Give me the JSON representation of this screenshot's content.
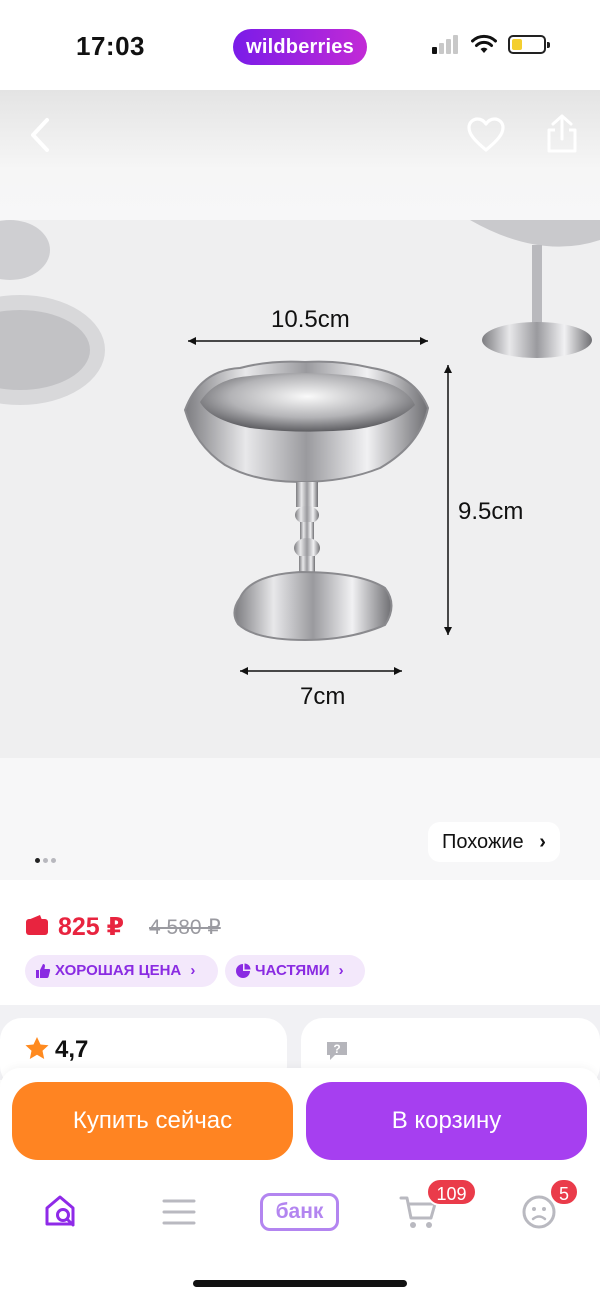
{
  "status_bar": {
    "time": "17:03",
    "brand": "wildberries"
  },
  "product_image": {
    "labels": {
      "top_width": "10.5cm",
      "height": "9.5cm",
      "base_width": "7cm"
    },
    "page_indicator": {
      "count": 3,
      "active": 0
    },
    "similar_button": "Похожие"
  },
  "price": {
    "current": "825 ₽",
    "old": "4 580 ₽",
    "chips": [
      {
        "label": "ХОРОШАЯ ЦЕНА",
        "icon": "thumbs-up-icon"
      },
      {
        "label": "ЧАСТЯМИ",
        "icon": "pie-chart-icon"
      }
    ]
  },
  "cards": {
    "rating": "4,7"
  },
  "actions": {
    "buy_now": "Купить сейчас",
    "add_to_cart": "В корзину"
  },
  "bottom_nav": {
    "bank_label": "банк",
    "cart_badge": "109",
    "profile_badge": "5"
  },
  "colors": {
    "accent_purple": "#a63ff0",
    "buy_orange": "#ff8422",
    "price_red": "#e8243f",
    "badge_red": "#ea3b4a",
    "chip_bg": "#f3e8fb"
  }
}
